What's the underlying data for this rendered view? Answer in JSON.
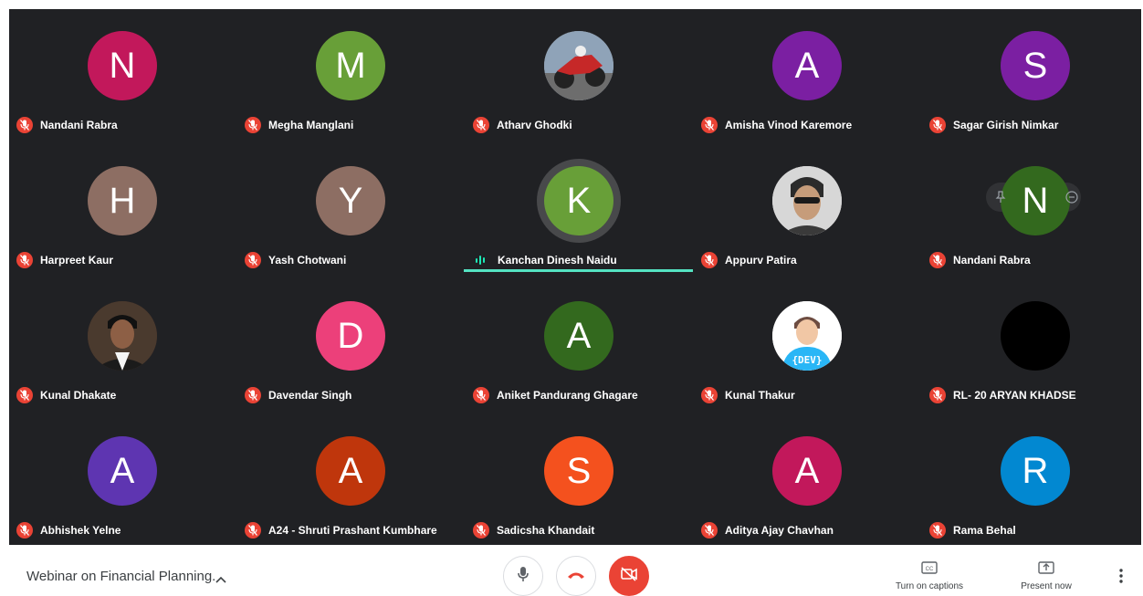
{
  "participants": [
    {
      "name": "Nandani Rabra",
      "initial": "N",
      "color": "#c2185b"
    },
    {
      "name": "Megha Manglani",
      "initial": "M",
      "color": "#689f38"
    },
    {
      "name": "Atharv Ghodki",
      "initial": "",
      "color": "#9e9e9e",
      "photo": "motorbike"
    },
    {
      "name": "Amisha Vinod Karemore",
      "initial": "A",
      "color": "#7b1fa2"
    },
    {
      "name": "Sagar Girish Nimkar",
      "initial": "S",
      "color": "#7b1fa2"
    },
    {
      "name": "Harpreet Kaur",
      "initial": "H",
      "color": "#8d6e63"
    },
    {
      "name": "Yash Chotwani",
      "initial": "Y",
      "color": "#8d6e63"
    },
    {
      "name": "Kanchan Dinesh Naidu",
      "initial": "K",
      "color": "#689f38",
      "speaking": true
    },
    {
      "name": "Appurv Patira",
      "initial": "",
      "color": "#e0e0e0",
      "photo": "person"
    },
    {
      "name": "Nandani Rabra",
      "initial": "N",
      "color": "#33691e",
      "hovered": true
    },
    {
      "name": "Kunal Dhakate",
      "initial": "",
      "color": "#3e2723",
      "photo": "person-dark"
    },
    {
      "name": "Davendar Singh",
      "initial": "D",
      "color": "#ec407a"
    },
    {
      "name": "Aniket Pandurang Ghagare",
      "initial": "A",
      "color": "#33691e"
    },
    {
      "name": "Kunal Thakur",
      "initial": "",
      "color": "#ffffff",
      "photo": "dev"
    },
    {
      "name": "RL- 20 ARYAN KHADSE",
      "initial": "",
      "color": "#000000",
      "photo": "black"
    },
    {
      "name": "Abhishek Yelne",
      "initial": "A",
      "color": "#5e35b1"
    },
    {
      "name": "A24 - Shruti Prashant Kumbhare",
      "initial": "A",
      "color": "#bf360c"
    },
    {
      "name": "Sadicsha Khandait",
      "initial": "S",
      "color": "#f4511e"
    },
    {
      "name": "Aditya Ajay Chavhan",
      "initial": "A",
      "color": "#c2185b"
    },
    {
      "name": "Rama Behal",
      "initial": "R",
      "color": "#0288d1"
    }
  ],
  "bottom_bar": {
    "meeting_title": "Webinar on Financial Planning.",
    "captions_label": "Turn on captions",
    "present_label": "Present now"
  },
  "icons": {
    "mic_off": "mic-off-icon",
    "mic": "mic-icon",
    "hangup": "hang-up-icon",
    "camera_off": "camera-off-icon",
    "captions": "closed-captions-icon",
    "present": "present-screen-icon",
    "more": "more-vert-icon",
    "chevron_up": "chevron-up-icon"
  },
  "colors": {
    "grid_bg": "#202124",
    "mute_red": "#ea4335",
    "speaking_teal": "#54e3c2"
  }
}
